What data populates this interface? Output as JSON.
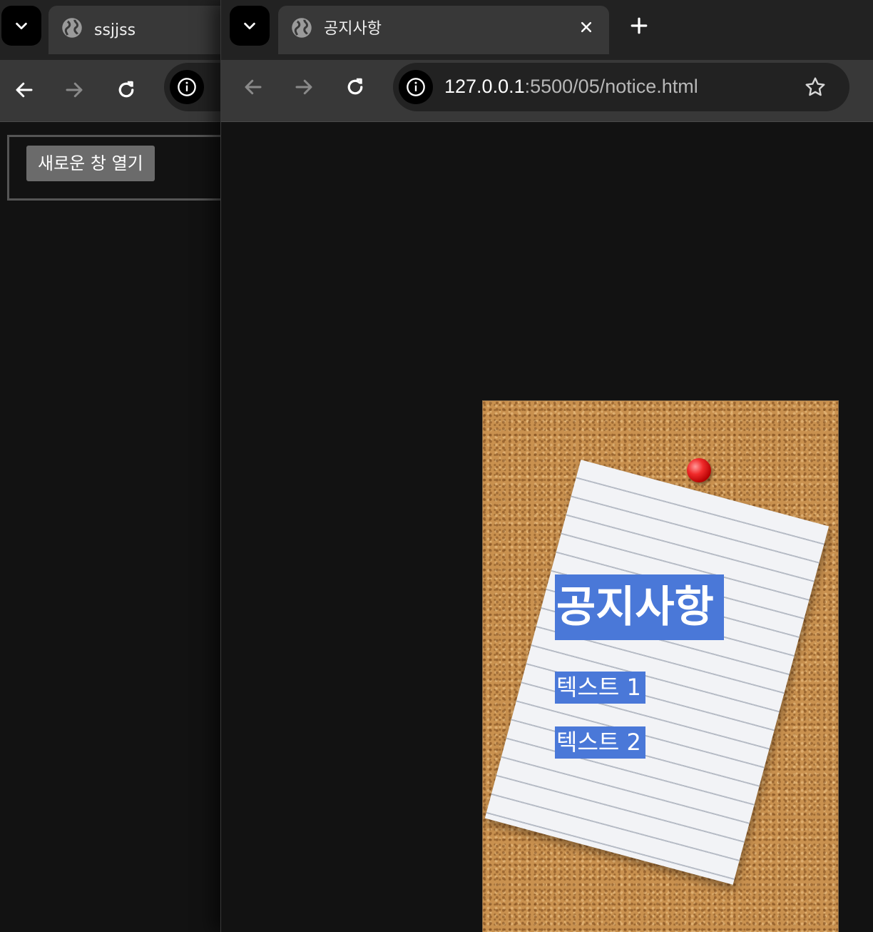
{
  "back_window": {
    "tab_title": "ssjjss",
    "open_button_label": "새로운 창 열기"
  },
  "front_window": {
    "tab_title": "공지사항",
    "url_host": "127.0.0.1",
    "url_rest": ":5500/05/notice.html"
  },
  "notice": {
    "title": "공지사항",
    "items": [
      "텍스트 1",
      "텍스트 2"
    ]
  },
  "colors": {
    "highlight": "#4a78d8",
    "cork": "#c9914f",
    "pin": "#f02a2a"
  }
}
